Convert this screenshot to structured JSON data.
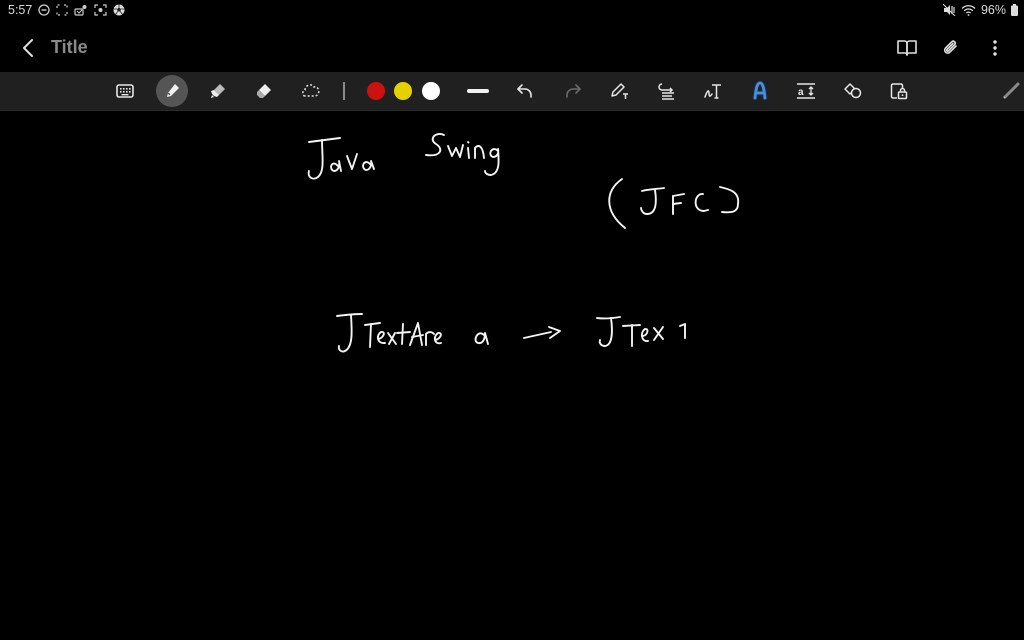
{
  "status_bar": {
    "time": "5:57",
    "left_icons": [
      "do-not-disturb-icon",
      "screenshot-frame-icon",
      "notification-icon",
      "screen-record-icon",
      "soccer-ball-icon"
    ],
    "right_icons": [
      "mute-icon",
      "wifi-icon"
    ],
    "battery_percent": "96%"
  },
  "app_bar": {
    "title": "Title",
    "actions": [
      "book-icon",
      "attach-icon",
      "more-options-icon"
    ]
  },
  "toolbar": {
    "tools": [
      "keyboard",
      "pen",
      "highlighter",
      "eraser",
      "lasso-select"
    ],
    "active_tool": "pen",
    "colors": [
      "#cc1111",
      "#e5d000",
      "#ffffff"
    ],
    "right_tools": [
      "pen-to-text",
      "text-align",
      "handwriting-to-text",
      "text-style",
      "text-size",
      "shapes",
      "lock-canvas"
    ],
    "accent_color": "#4a8cd6"
  },
  "canvas": {
    "handwriting_lines": [
      "Java Swing",
      "(JFC)",
      "JTextArea -> JText"
    ]
  }
}
